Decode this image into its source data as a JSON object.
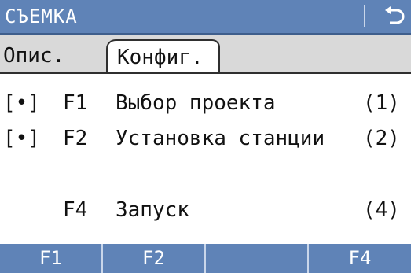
{
  "titlebar": {
    "title": "СЪЕМКА",
    "back_icon": "return-arrow-icon"
  },
  "tabs": {
    "inactive_label": "Опис.",
    "active_label": "Конфиг."
  },
  "rows": [
    {
      "mark": "[•]",
      "key": "F1",
      "label": "Выбор проекта",
      "num": "(1)"
    },
    {
      "mark": "[•]",
      "key": "F2",
      "label": "Установка станции",
      "num": "(2)"
    },
    {
      "mark": "",
      "key": "F4",
      "label": "Запуск",
      "num": "(4)"
    }
  ],
  "softkeys": [
    "F1",
    "F2",
    "",
    "F4"
  ],
  "colors": {
    "accent": "#5f83b7",
    "tabstrip": "#d9d9d9",
    "text": "#111111"
  }
}
